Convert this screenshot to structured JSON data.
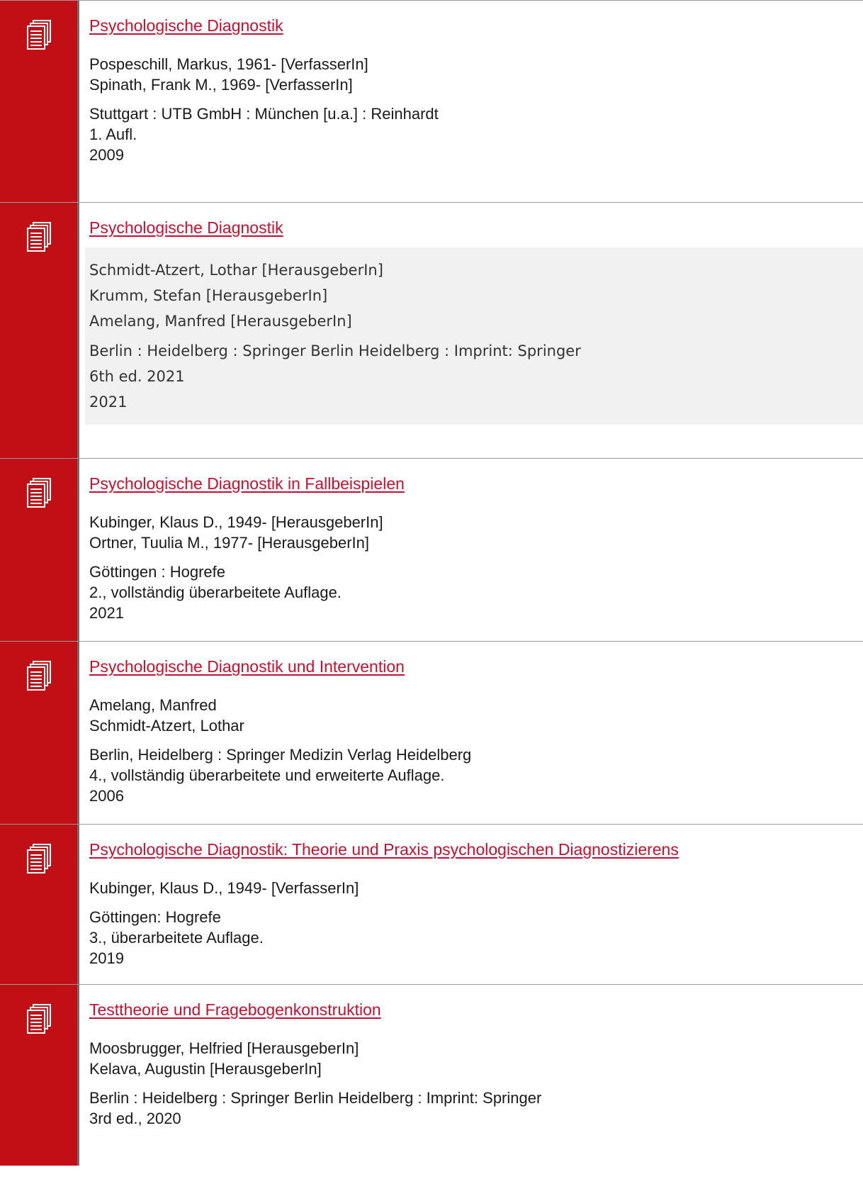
{
  "results": [
    {
      "title": "Psychologische Diagnostik",
      "authors": [
        "Pospeschill, Markus, 1961- [VerfasserIn]",
        "Spinath, Frank M., 1969- [VerfasserIn]"
      ],
      "publication": [
        "Stuttgart : UTB GmbH : München [u.a.] : Reinhardt",
        "1. Aufl.",
        "2009"
      ],
      "icon": "document-stack-icon"
    },
    {
      "title": "Psychologische Diagnostik",
      "authors": [
        "Schmidt-Atzert, Lothar [HerausgeberIn]",
        "Krumm, Stefan [HerausgeberIn]",
        "Amelang, Manfred [HerausgeberIn]"
      ],
      "publication": [
        "Berlin : Heidelberg : Springer Berlin Heidelberg : Imprint: Springer",
        "6th ed. 2021",
        "2021"
      ],
      "icon": "document-stack-icon"
    },
    {
      "title": "Psychologische Diagnostik in Fallbeispielen",
      "authors": [
        "Kubinger, Klaus D., 1949- [HerausgeberIn]",
        "Ortner, Tuulia M., 1977- [HerausgeberIn]"
      ],
      "publication": [
        "Göttingen : Hogrefe",
        "2., vollständig überarbeitete Auflage.",
        "2021"
      ],
      "icon": "document-stack-icon"
    },
    {
      "title": "Psychologische Diagnostik und Intervention",
      "authors": [
        "Amelang, Manfred",
        "Schmidt-Atzert, Lothar"
      ],
      "publication": [
        "Berlin, Heidelberg : Springer Medizin Verlag Heidelberg",
        "4., vollständig überarbeitete und erweiterte Auflage.",
        "2006"
      ],
      "icon": "document-stack-icon"
    },
    {
      "title": "Psychologische Diagnostik: Theorie und Praxis psychologischen Diagnostizierens",
      "authors": [
        "Kubinger, Klaus D., 1949- [VerfasserIn]"
      ],
      "publication": [
        "Göttingen: Hogrefe",
        "3., überarbeitete Auflage.",
        "2019"
      ],
      "icon": "document-stack-icon"
    },
    {
      "title": "Testtheorie und Fragebogenkonstruktion",
      "authors": [
        "Moosbrugger, Helfried [HerausgeberIn]",
        "Kelava, Augustin [HerausgeberIn]"
      ],
      "publication": [
        "Berlin : Heidelberg : Springer Berlin Heidelberg : Imprint: Springer",
        "3rd ed., 2020"
      ],
      "icon": "document-stack-icon"
    }
  ],
  "colors": {
    "sidebar": "#c01016",
    "link": "#c8102e",
    "highlight": "#f1f1f1"
  }
}
